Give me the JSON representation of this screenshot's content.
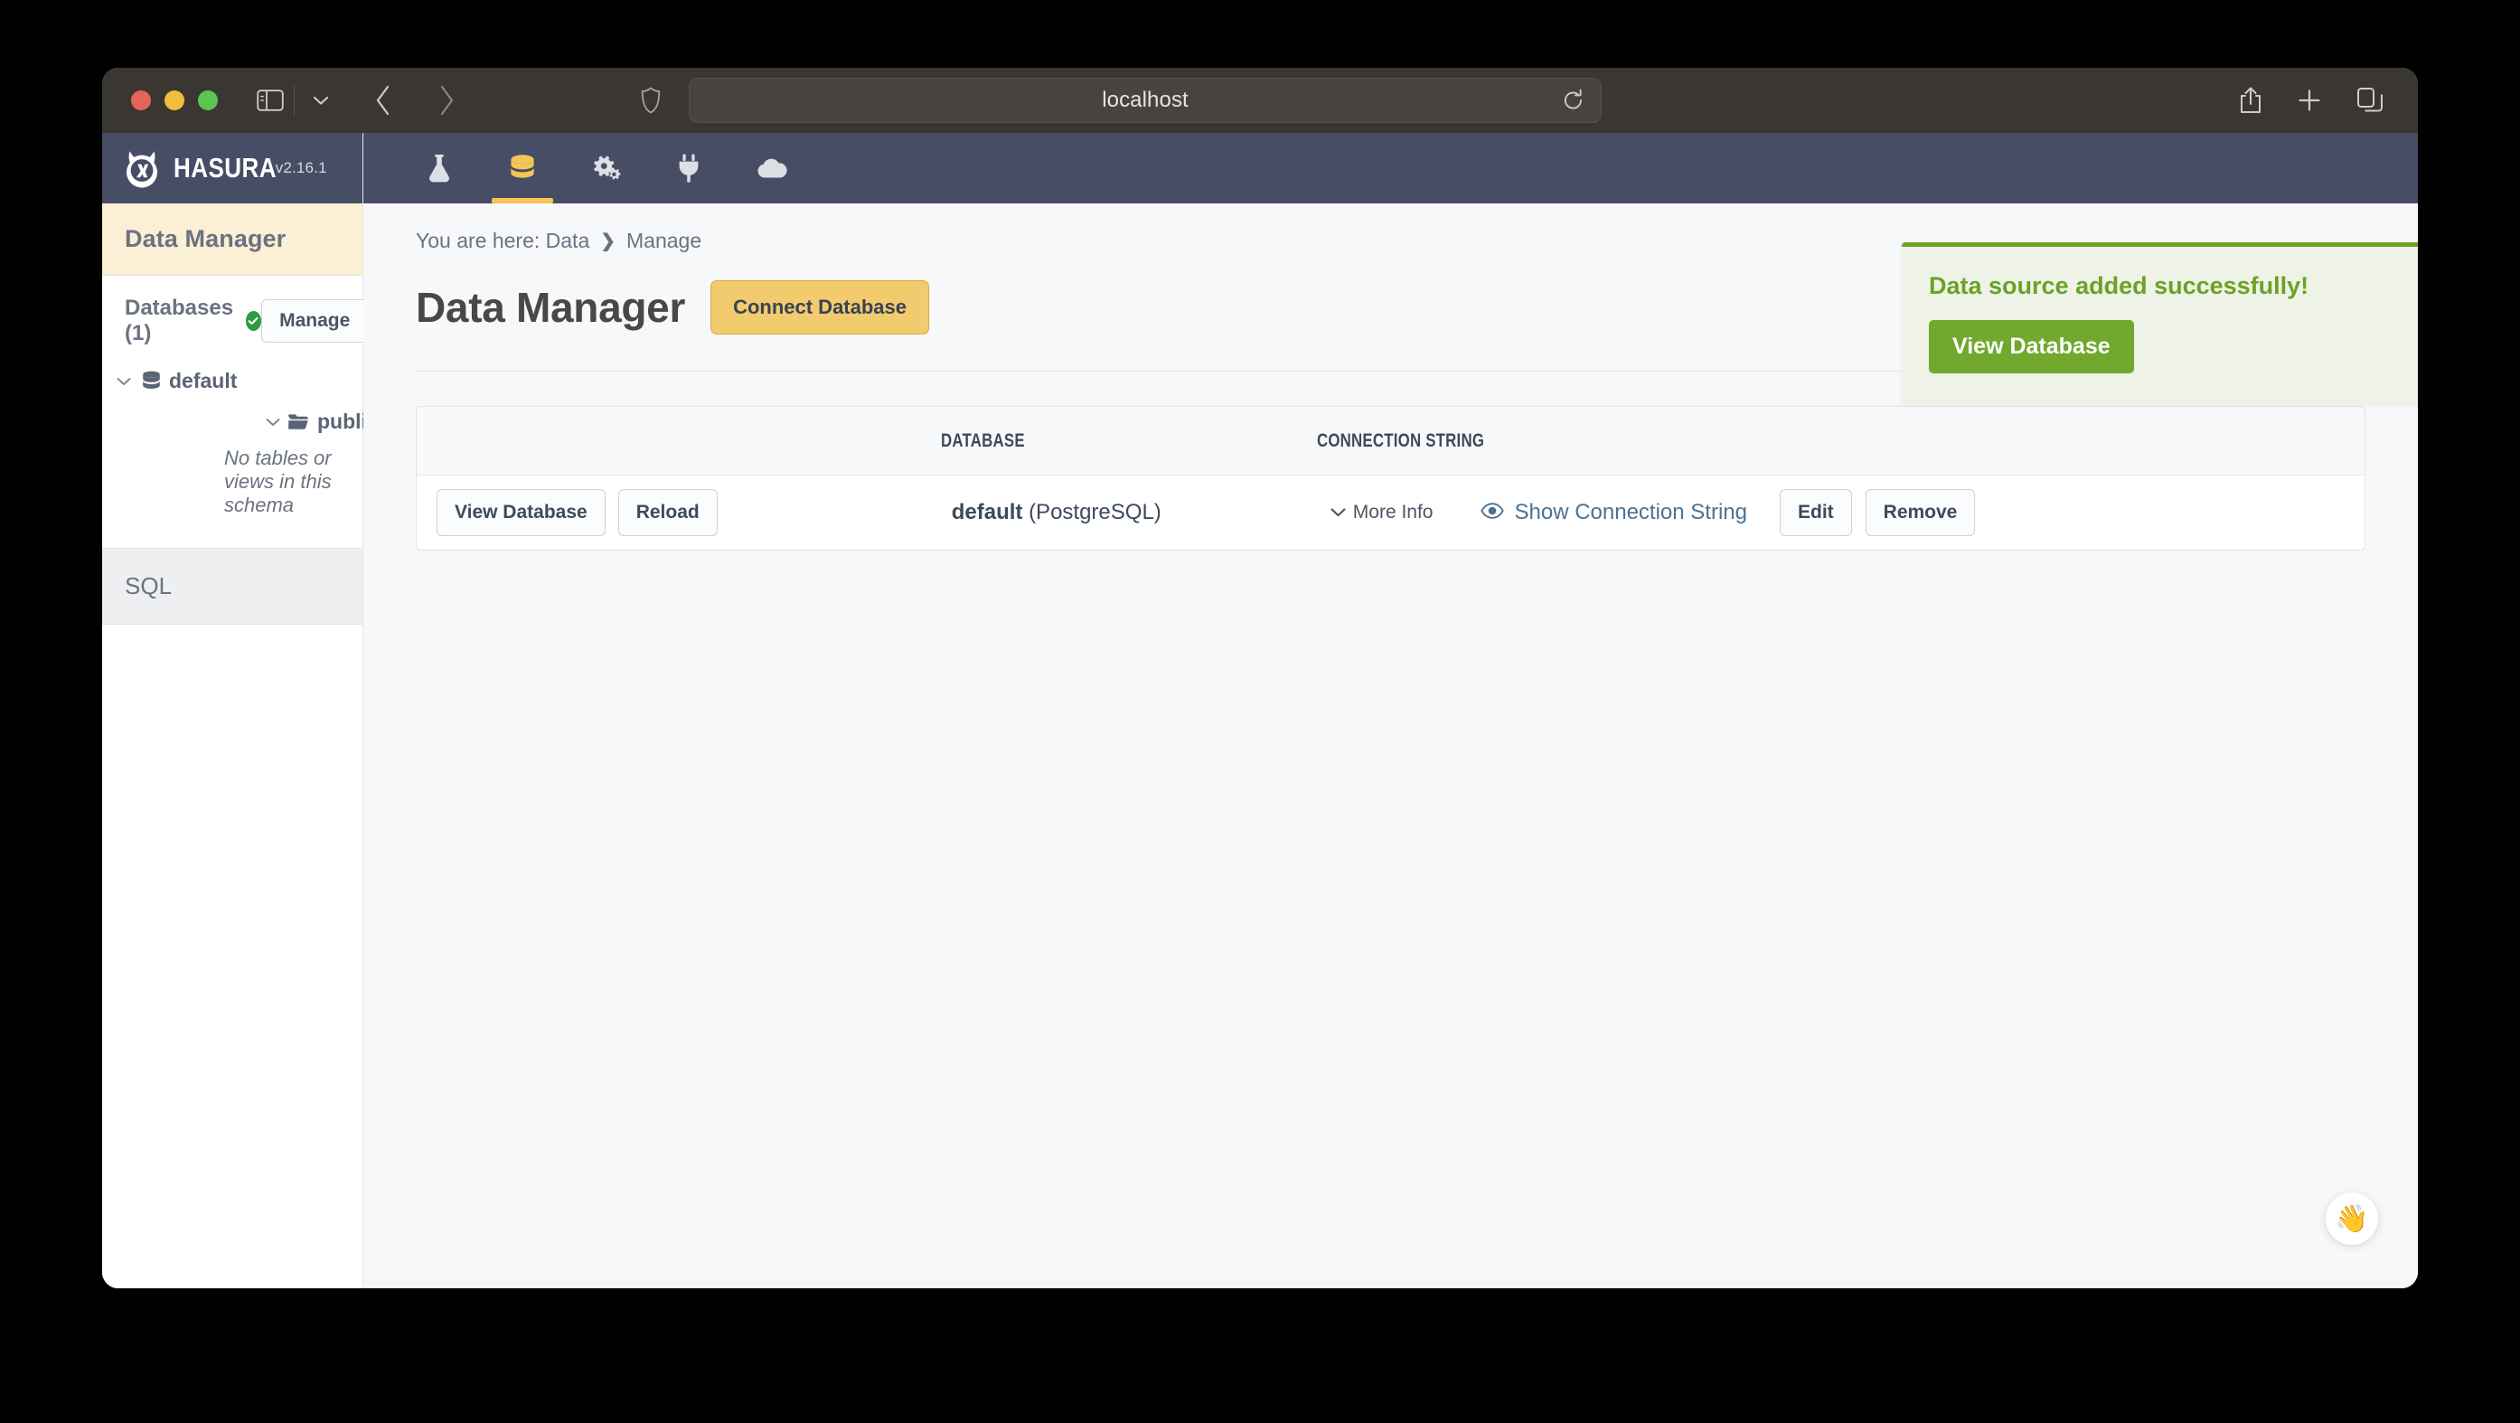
{
  "browser": {
    "url": "localhost",
    "traffic_lights": [
      "close",
      "minimize",
      "zoom"
    ],
    "icons": {
      "sidebar_toggle": "sidebar-icon",
      "sidebar_dropdown": "chevron-down-icon",
      "back": "chevron-left-icon",
      "forward": "chevron-right-icon",
      "shield": "shield-icon",
      "reload": "reload-icon",
      "share": "share-icon",
      "new_tab": "plus-icon",
      "tab_overview": "tab-overview-icon"
    }
  },
  "brand": {
    "name": "HASURA",
    "version": "v2.16.1",
    "logo_icon": "hasura-lambda-logo"
  },
  "topnav": {
    "items": [
      {
        "icon": "flask-icon",
        "name": "api",
        "active": false
      },
      {
        "icon": "database-icon",
        "name": "data",
        "active": true
      },
      {
        "icon": "gears-icon",
        "name": "actions",
        "active": false
      },
      {
        "icon": "plug-icon",
        "name": "events",
        "active": false
      },
      {
        "icon": "cloud-icon",
        "name": "cloud",
        "active": false
      }
    ],
    "accent_color": "#f5c455",
    "background_color": "#464d64"
  },
  "sidebar": {
    "title": "Data Manager",
    "databases_label": "Databases (1)",
    "databases_status": "connected",
    "manage_label": "Manage",
    "tree": {
      "database": "default",
      "schema": "public",
      "empty_note": "No tables or views in this schema"
    },
    "sql_label": "SQL"
  },
  "breadcrumb": {
    "prefix": "You are here: Data",
    "separator": "❯",
    "current": "Manage"
  },
  "main": {
    "page_title": "Data Manager",
    "connect_database_label": "Connect Database",
    "table": {
      "headers": [
        "DATABASE",
        "CONNECTION STRING"
      ],
      "rows": [
        {
          "view_database_label": "View Database",
          "reload_label": "Reload",
          "database_name": "default",
          "database_kind": "(PostgreSQL)",
          "more_info_label": "More Info",
          "show_connection_string_label": "Show Connection String",
          "edit_label": "Edit",
          "remove_label": "Remove"
        }
      ]
    }
  },
  "toast": {
    "message": "Data source added successfully!",
    "action_label": "View Database",
    "accent_color": "#6aa327",
    "background_color": "#eff2e7"
  },
  "help_bubble": {
    "icon": "waving-hand-icon",
    "glyph": "👋"
  }
}
